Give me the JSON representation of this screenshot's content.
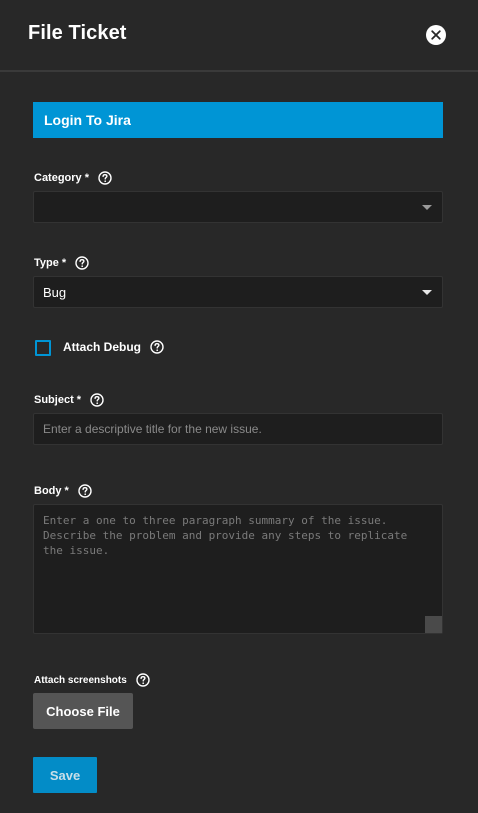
{
  "dialog": {
    "title": "File Ticket",
    "close_icon": "close-icon"
  },
  "login": {
    "label": "Login To Jira"
  },
  "category": {
    "label": "Category",
    "required_mark": "*",
    "value": ""
  },
  "type": {
    "label": "Type",
    "required_mark": "*",
    "value": "Bug"
  },
  "attach_debug": {
    "label": "Attach Debug",
    "checked": false
  },
  "subject": {
    "label": "Subject",
    "required_mark": "*",
    "placeholder": "Enter a descriptive title for the new issue."
  },
  "body": {
    "label": "Body",
    "required_mark": "*",
    "placeholder": "Enter a one to three paragraph summary of the issue. Describe the problem and provide any steps to replicate the issue."
  },
  "screenshots": {
    "label": "Attach screenshots",
    "choose_label": "Choose File"
  },
  "actions": {
    "save_label": "Save"
  },
  "colors": {
    "background": "#282828",
    "accent": "#0095d5",
    "field_bg": "#1e1e1e",
    "button_gray": "#555555"
  }
}
